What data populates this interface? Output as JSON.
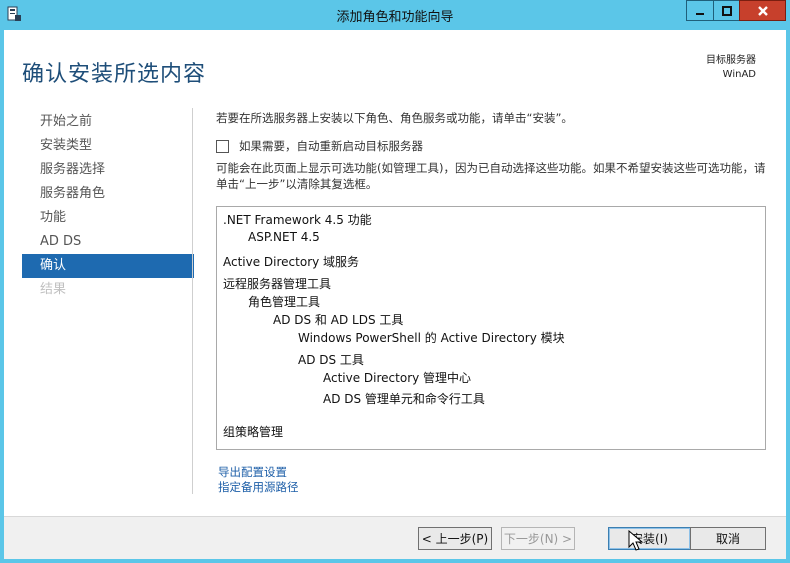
{
  "window": {
    "title": "添加角色和功能向导"
  },
  "header": {
    "title": "确认安装所选内容",
    "target_label": "目标服务器",
    "target_server": "WinAD"
  },
  "nav": {
    "items": [
      {
        "label": "开始之前",
        "state": "normal"
      },
      {
        "label": "安装类型",
        "state": "normal"
      },
      {
        "label": "服务器选择",
        "state": "normal"
      },
      {
        "label": "服务器角色",
        "state": "normal"
      },
      {
        "label": "功能",
        "state": "normal"
      },
      {
        "label": "AD DS",
        "state": "normal"
      },
      {
        "label": "确认",
        "state": "active"
      },
      {
        "label": "结果",
        "state": "disabled"
      }
    ]
  },
  "content": {
    "intro": "若要在所选服务器上安装以下角色、角色服务或功能，请单击“安装”。",
    "restart_label": "如果需要，自动重新启动目标服务器",
    "restart_checked": false,
    "note": "可能会在此页面上显示可选功能(如管理工具)，因为已自动选择这些功能。如果不希望安装这些可选功能，请单击“上一步”以清除其复选框。",
    "features": [
      {
        "text": ".NET Framework 4.5 功能",
        "level": 0
      },
      {
        "text": "ASP.NET 4.5",
        "level": 1
      },
      {
        "text": "Active Directory 域服务",
        "level": 0
      },
      {
        "text": "远程服务器管理工具",
        "level": 0
      },
      {
        "text": "角色管理工具",
        "level": 1
      },
      {
        "text": "AD DS 和 AD LDS 工具",
        "level": 2
      },
      {
        "text": "Windows PowerShell 的 Active Directory 模块",
        "level": 3
      },
      {
        "text": "AD DS 工具",
        "level": 3
      },
      {
        "text": "Active Directory 管理中心",
        "level": 4
      },
      {
        "text": "AD DS 管理单元和命令行工具",
        "level": 4
      },
      {
        "text": "组策略管理",
        "level": 0
      }
    ]
  },
  "links": {
    "export": "导出配置设置",
    "alternate_source": "指定备用源路径"
  },
  "footer": {
    "prev": "< 上一步(P)",
    "next": "下一步(N) >",
    "install": "安装(I)",
    "cancel": "取消"
  },
  "colors": {
    "titlebar": "#5bc6e8",
    "accent": "#1e6ab0",
    "heading": "#1e4e79",
    "link": "#1e5fa8",
    "close": "#c7402c"
  }
}
